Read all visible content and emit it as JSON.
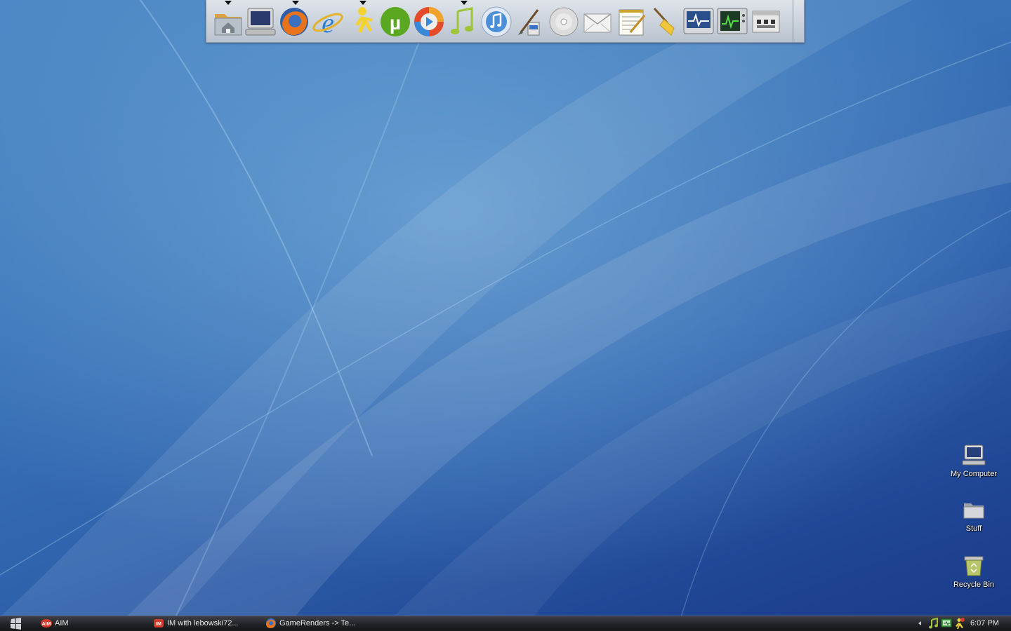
{
  "dock": {
    "items": [
      {
        "name": "home-folder",
        "has_menu": true
      },
      {
        "name": "my-computer",
        "has_menu": false
      },
      {
        "name": "firefox",
        "has_menu": true
      },
      {
        "name": "internet-explorer",
        "has_menu": false
      },
      {
        "name": "aim",
        "has_menu": true
      },
      {
        "name": "utorrent",
        "has_menu": false
      },
      {
        "name": "media-player",
        "has_menu": false
      },
      {
        "name": "music-note",
        "has_menu": true
      },
      {
        "name": "itunes",
        "has_menu": false
      },
      {
        "name": "paint",
        "has_menu": false
      },
      {
        "name": "cd-drive",
        "has_menu": false
      },
      {
        "name": "mail",
        "has_menu": false
      },
      {
        "name": "notepad",
        "has_menu": false
      },
      {
        "name": "cleaner-broom",
        "has_menu": false
      },
      {
        "name": "system-monitor",
        "has_menu": false
      },
      {
        "name": "performance-monitor",
        "has_menu": false
      },
      {
        "name": "control-panel",
        "has_menu": false
      }
    ]
  },
  "desktop_icons": {
    "my_computer": "My Computer",
    "stuff": "Stuff",
    "recycle_bin": "Recycle Bin"
  },
  "taskbar": {
    "tasks": [
      {
        "label": "AIM",
        "icon": "aim-icon"
      },
      {
        "label": "IM with lebowski72...",
        "icon": "im-icon"
      },
      {
        "label": "GameRenders -> Te...",
        "icon": "firefox-icon"
      }
    ],
    "clock": "6:07 PM"
  },
  "colors": {
    "wallpaper_light": "#6aa3d6",
    "wallpaper_dark": "#1a3a88",
    "taskbar": "#1e2024"
  }
}
